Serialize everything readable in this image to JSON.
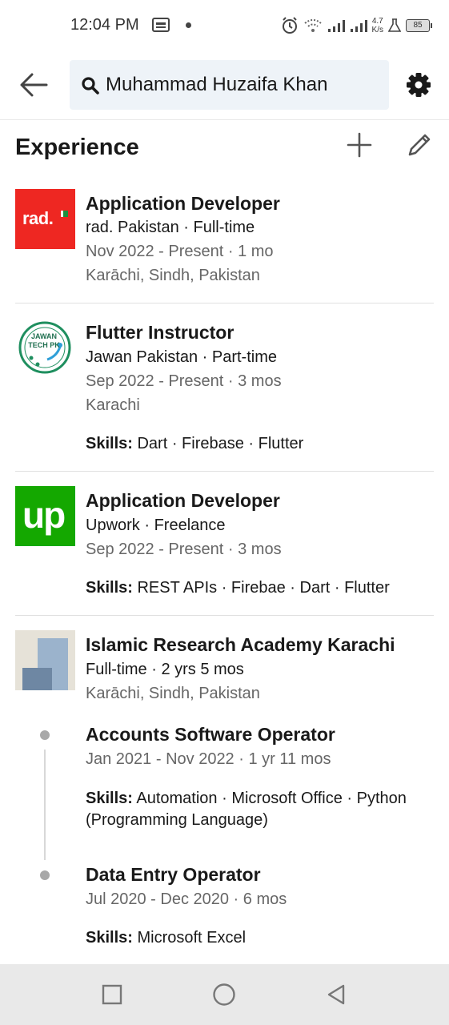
{
  "status_bar": {
    "time": "12:04 PM",
    "net_speed_value": "4.7",
    "net_speed_unit": "K/s",
    "battery": "85"
  },
  "search": {
    "query": "Muhammad Huzaifa Khan"
  },
  "section": {
    "title": "Experience"
  },
  "skills_label": "Skills:",
  "experiences": [
    {
      "logo_text": "rad.",
      "title": "Application Developer",
      "company": "rad. Pakistan · Full-time",
      "dates": "Nov 2022 - Present · 1 mo",
      "location": "Karāchi, Sindh, Pakistan"
    },
    {
      "logo_text": "JAWAN TECH PK",
      "title": "Flutter Instructor",
      "company": "Jawan Pakistan · Part-time",
      "dates": "Sep 2022 - Present · 3 mos",
      "location": "Karachi",
      "skills": "Dart · Firebase · Flutter"
    },
    {
      "logo_text": "up",
      "title": "Application Developer",
      "company": "Upwork · Freelance",
      "dates": "Sep 2022 - Present · 3 mos",
      "skills": "REST APIs · Firebae · Dart · Flutter"
    },
    {
      "title": "Islamic Research Academy Karachi",
      "company": "Full-time · 2 yrs 5 mos",
      "location": "Karāchi, Sindh, Pakistan",
      "roles": [
        {
          "title": "Accounts Software Operator",
          "dates": "Jan 2021 - Nov 2022 · 1 yr 11 mos",
          "skills": "Automation · Microsoft Office · Python (Programming Language)"
        },
        {
          "title": "Data Entry Operator",
          "dates": "Jul 2020 - Dec 2020 · 6 mos",
          "skills": "Microsoft Excel"
        }
      ]
    }
  ],
  "colors": {
    "rad_red": "#ee2722",
    "upwork_green": "#14a800",
    "jawan_green": "#1f8f5f",
    "search_bg": "#eef3f8"
  }
}
